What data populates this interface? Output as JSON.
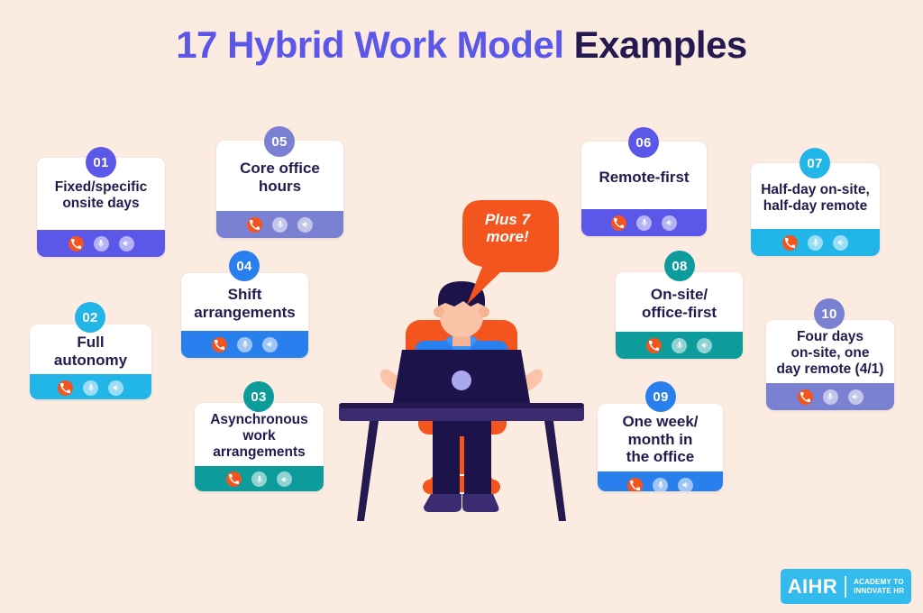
{
  "background_color": "#FCEBE1",
  "title": {
    "accent_text": "17 Hybrid Work Model ",
    "dark_text": "Examples",
    "accent_color": "#5B57E8",
    "dark_color": "#241A4F"
  },
  "bubble": {
    "text": "Plus 7\nmore!",
    "color": "#F4551E"
  },
  "card_icons": {
    "hangup": "phone-icon",
    "mic": "microphone-icon",
    "speaker": "speaker-icon"
  },
  "logo": {
    "main": "AIHR",
    "sub": "ACADEMY TO\nINNOVATE HR",
    "color": "#33BBEE"
  },
  "cards": [
    {
      "number": "01",
      "title": "Fixed/specific\nonsite days",
      "bar_color": "#5B57E8",
      "badge_color": "#5B57E8"
    },
    {
      "number": "02",
      "title": "Full\nautonomy",
      "bar_color": "#21B5E8",
      "badge_color": "#21B5E8"
    },
    {
      "number": "03",
      "title": "Asynchronous\nwork\narrangements",
      "bar_color": "#0D9B9B",
      "badge_color": "#0D9B9B"
    },
    {
      "number": "04",
      "title": "Shift\narrangements",
      "bar_color": "#2A7FEE",
      "badge_color": "#2A7FEE"
    },
    {
      "number": "05",
      "title": "Core office\nhours",
      "bar_color": "#7B81D2",
      "badge_color": "#7B81D2"
    },
    {
      "number": "06",
      "title": "Remote-first",
      "bar_color": "#5B57E8",
      "badge_color": "#5B57E8"
    },
    {
      "number": "07",
      "title": "Half-day on-site,\nhalf-day remote",
      "bar_color": "#21B5E8",
      "badge_color": "#21B5E8"
    },
    {
      "number": "08",
      "title": "On-site/\noffice-first",
      "bar_color": "#0D9B9B",
      "badge_color": "#0D9B9B"
    },
    {
      "number": "09",
      "title": "One week/\nmonth in\nthe office",
      "bar_color": "#2A7FEE",
      "badge_color": "#2A7FEE"
    },
    {
      "number": "10",
      "title": "Four days\non-site, one\nday remote (4/1)",
      "bar_color": "#7B81D2",
      "badge_color": "#7B81D2"
    }
  ]
}
